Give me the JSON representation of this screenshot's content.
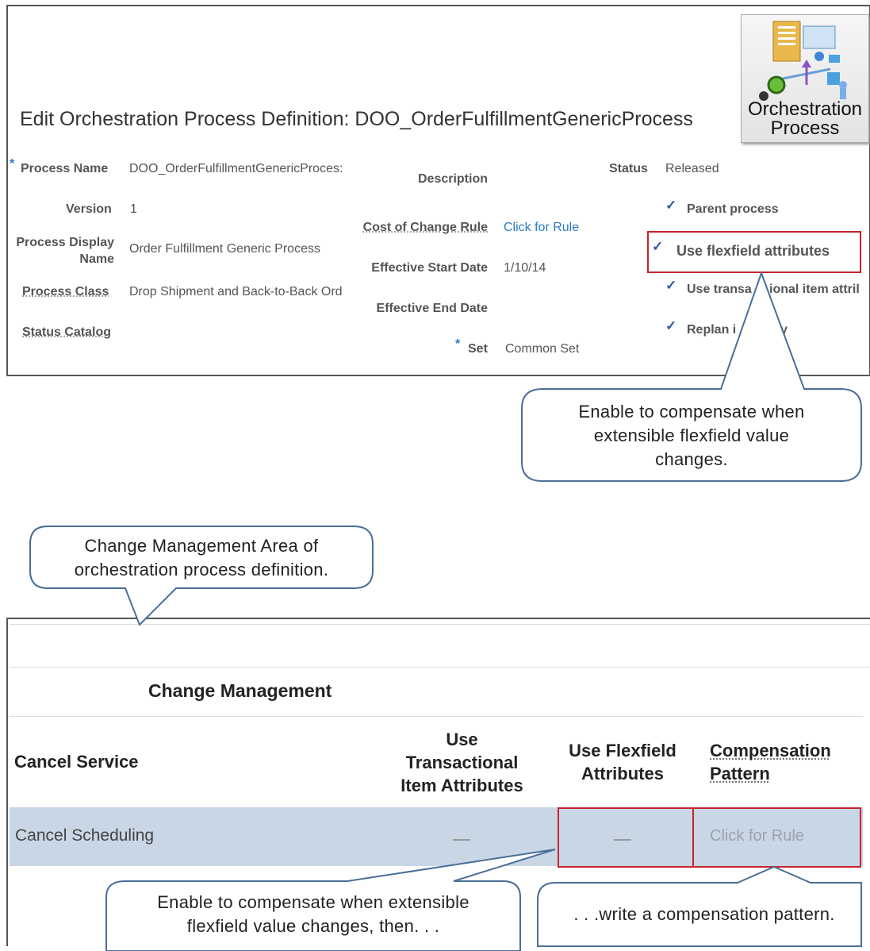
{
  "page": {
    "title": "Edit Orchestration Process Definition: DOO_OrderFulfillmentGenericProcess",
    "icon_caption_line1": "Orchestration",
    "icon_caption_line2": "Process"
  },
  "fields": {
    "process_name_label": "Process Name",
    "process_name_value": "DOO_OrderFulfillmentGenericProces:",
    "version_label": "Version",
    "version_value": "1",
    "display_name_label_line1": "Process Display",
    "display_name_label_line2": "Name",
    "display_name_value": "Order Fulfillment Generic Process",
    "process_class_label": "Process Class",
    "process_class_value": "Drop Shipment and Back-to-Back Ord",
    "status_catalog_label": "Status Catalog",
    "description_label": "Description",
    "cost_of_change_label": "Cost of Change Rule",
    "cost_of_change_value": "Click for Rule",
    "effective_start_label": "Effective Start Date",
    "effective_start_value": "1/10/14",
    "effective_end_label": "Effective End Date",
    "set_label": "Set",
    "set_value": "Common Set",
    "status_label": "Status",
    "status_value": "Released",
    "required_marker": "*"
  },
  "checkboxes": {
    "check_glyph": "✓",
    "parent_process": "Parent process",
    "use_flexfield": "Use flexfield attributes",
    "use_transactional_left": "Use transa",
    "use_transactional_right": "ional item attril",
    "replan_left": "Replan i",
    "replan_right": "y"
  },
  "callouts": {
    "flexfield_line1": "Enable to compensate when",
    "flexfield_line2": "extensible flexfield value",
    "flexfield_line3": "changes.",
    "change_mgmt_line1": "Change Management Area of",
    "change_mgmt_line2": "orchestration process definition.",
    "enable_then_line1": "Enable to compensate when extensible",
    "enable_then_line2": "flexfield value changes, then. . .",
    "write_pattern": ". . .write a compensation pattern."
  },
  "change_management": {
    "section_title": "Change Management",
    "headers": {
      "cancel_service": "Cancel Service",
      "use_transactional_1": "Use",
      "use_transactional_2": "Transactional",
      "use_transactional_3": "Item Attributes",
      "use_flexfield_1": "Use Flexfield",
      "use_flexfield_2": "Attributes",
      "compensation_1": "Compensation",
      "compensation_2": "Pattern"
    },
    "rows": [
      {
        "cancel_service": "Cancel Scheduling",
        "compensation_pattern": "Click for Rule"
      }
    ]
  },
  "colors": {
    "accent_blue": "#2a7bc4",
    "highlight_red": "#c8232c",
    "row_highlight": "#c9d6e6"
  }
}
